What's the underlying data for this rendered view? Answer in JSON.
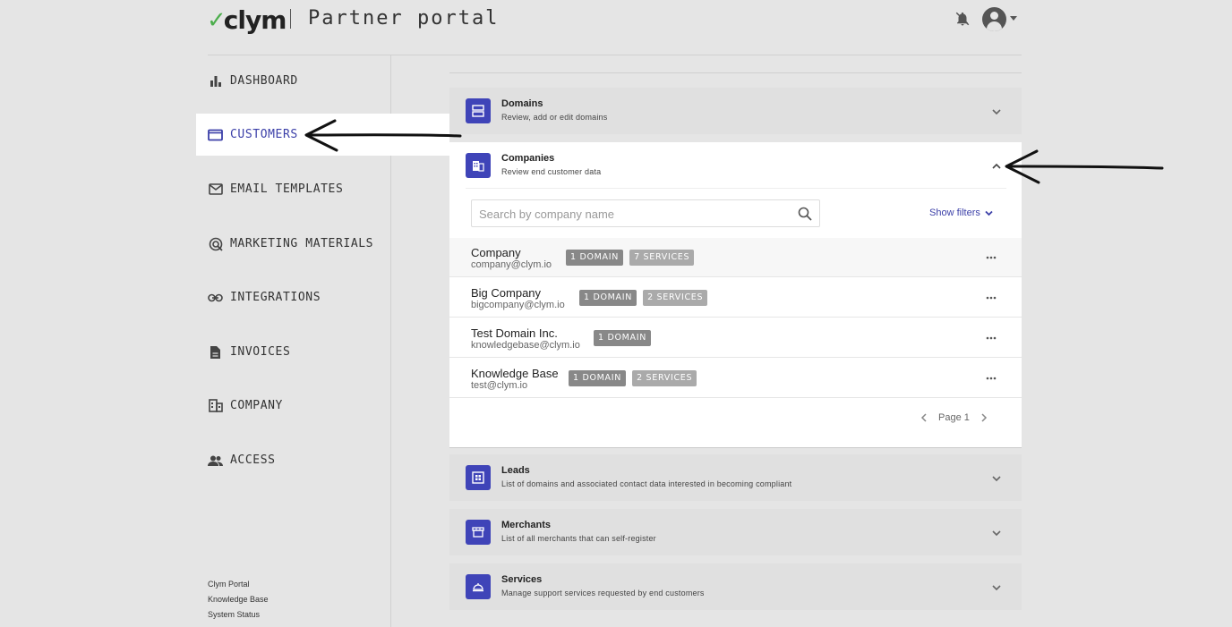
{
  "header": {
    "logo_text": "clym",
    "portal_title": "Partner portal",
    "bell_icon": "notifications-off-icon",
    "avatar_icon": "account-circle-icon"
  },
  "sidebar": {
    "items": [
      {
        "label": "DASHBOARD",
        "icon": "bar-chart-icon"
      },
      {
        "label": "CUSTOMERS",
        "icon": "folder-icon",
        "active": true
      },
      {
        "label": "EMAIL TEMPLATES",
        "icon": "mail-icon"
      },
      {
        "label": "MARKETING MATERIALS",
        "icon": "target-icon"
      },
      {
        "label": "INTEGRATIONS",
        "icon": "link-icon"
      },
      {
        "label": "INVOICES",
        "icon": "document-icon"
      },
      {
        "label": "COMPANY",
        "icon": "building-icon"
      },
      {
        "label": "ACCESS",
        "icon": "people-icon"
      }
    ],
    "footer": [
      "Clym Portal",
      "Knowledge Base",
      "System Status"
    ]
  },
  "panels": {
    "domains": {
      "title": "Domains",
      "subtitle": "Review, add or edit domains"
    },
    "companies": {
      "title": "Companies",
      "subtitle": "Review end customer data"
    },
    "leads": {
      "title": "Leads",
      "subtitle": "List of domains and associated contact data interested in becoming compliant"
    },
    "merchants": {
      "title": "Merchants",
      "subtitle": "List of all merchants that can self-register"
    },
    "services": {
      "title": "Services",
      "subtitle": "Manage support services requested by end customers"
    }
  },
  "companies": {
    "search_placeholder": "Search by company name",
    "show_filters": "Show filters",
    "rows": [
      {
        "name": "Company",
        "email": "company@clym.io",
        "domains": "1 DOMAIN",
        "services": "7 SERVICES"
      },
      {
        "name": "Big Company",
        "email": "bigcompany@clym.io",
        "domains": "1 DOMAIN",
        "services": "2 SERVICES"
      },
      {
        "name": "Test Domain Inc.",
        "email": "knowledgebase@clym.io",
        "domains": "1 DOMAIN",
        "services": ""
      },
      {
        "name": "Knowledge Base",
        "email": "test@clym.io",
        "domains": "1 DOMAIN",
        "services": "2 SERVICES"
      }
    ],
    "page_label": "Page 1"
  },
  "colors": {
    "accent": "#3f44b8",
    "background": "#e5e5e5",
    "badge": "#888888"
  }
}
